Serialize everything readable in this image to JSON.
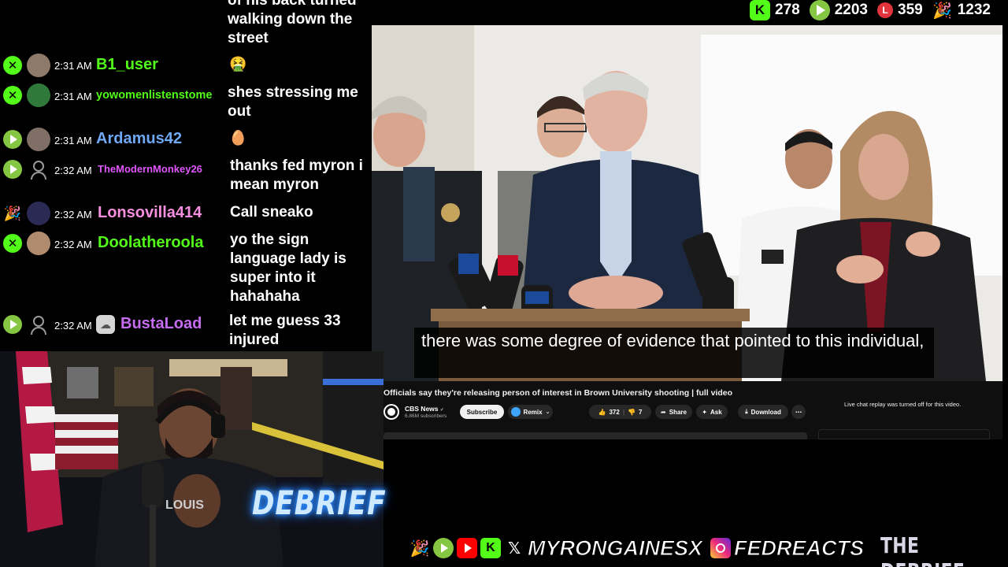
{
  "stats": [
    {
      "platform": "kick-icon",
      "value": "278"
    },
    {
      "platform": "rumble-icon",
      "value": "2203"
    },
    {
      "platform": "locals-icon",
      "value": "359"
    },
    {
      "platform": "party-popper-icon",
      "value": "1232"
    }
  ],
  "chat": {
    "partial_text": "of his back turned walking down the street",
    "messages": [
      {
        "time": "2:31 AM",
        "user": "B1_user",
        "color": "#53fc18",
        "platform": "kick",
        "emoji": "🤮"
      },
      {
        "time": "2:31 AM",
        "user": "yowomenlistenstome",
        "color": "#53fc18",
        "platform": "kick",
        "text": "shes stressing me out"
      },
      {
        "time": "2:31 AM",
        "user": "Ardamus42",
        "color": "#6fa8f5",
        "platform": "rumble",
        "emoji": "🥚"
      },
      {
        "time": "2:32 AM",
        "user": "TheModernMonkey26",
        "color": "#e056fd",
        "platform": "rumble",
        "text": "thanks fed myron i mean myron"
      },
      {
        "time": "2:32 AM",
        "user": "Lonsovilla414",
        "color": "#f78fe0",
        "platform": "party",
        "text": "Call sneako"
      },
      {
        "time": "2:32 AM",
        "user": "Doolatheroola",
        "color": "#53fc18",
        "platform": "kick",
        "text": "yo the sign language lady is super into it hahahaha"
      },
      {
        "time": "2:32 AM",
        "user": "BustaLoad",
        "color": "#c56cf0",
        "platform": "rumble",
        "text": "let me guess 33 injured"
      }
    ]
  },
  "video": {
    "caption": "there was some degree of evidence that pointed to this individual,",
    "title": "Officials say they're releasing person of interest in Brown University shooting | full video",
    "channel": "CBS News",
    "verified": "✔",
    "subscribers": "6.86M subscribers",
    "subscribe_label": "Subscribe",
    "remix_label": "Remix",
    "likes": "372",
    "dislikes": "7",
    "share_label": "Share",
    "ask_label": "Ask",
    "download_label": "Download",
    "more_label": "⋯",
    "chat_replay_notice": "Live chat replay was turned off for this video."
  },
  "webcam": {
    "neon_sign": "DEBRIEF"
  },
  "footer": {
    "handle": "MYRONGAINESX",
    "handle2": "FEDREACTS",
    "brand": "THE DEBRIEF"
  }
}
